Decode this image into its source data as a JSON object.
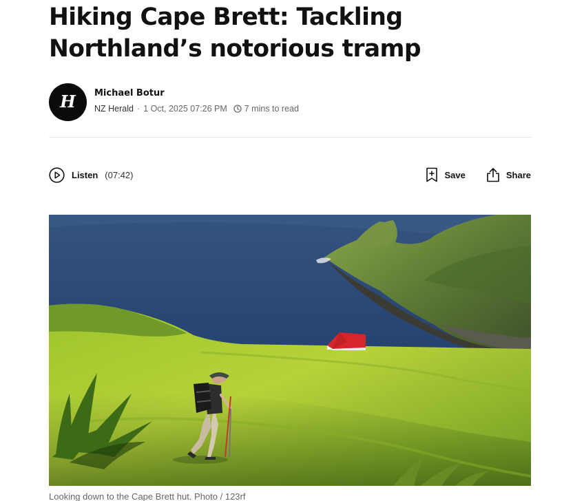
{
  "article": {
    "headline": "Hiking Cape Brett: Tackling Northland’s notorious tramp",
    "author": {
      "name": "Michael Botur",
      "avatar_glyph": "H"
    },
    "publisher": "NZ Herald",
    "separator": "·",
    "date": "1 Oct, 2025 07:26 PM",
    "read_time": "7 mins to read"
  },
  "actions": {
    "listen_label": "Listen",
    "listen_duration": "(07:42)",
    "save_label": "Save",
    "share_label": "Share"
  },
  "hero_image": {
    "caption": "Looking down to the Cape Brett hut. Photo / 123rf"
  },
  "icons": {
    "play": "play-circle-icon",
    "clock": "clock-icon",
    "bookmark": "bookmark-plus-icon",
    "share": "share-icon"
  },
  "colors": {
    "text": "#111111",
    "muted": "#666666",
    "divider": "#e3e3e3",
    "avatar_bg": "#0b0b0b"
  }
}
